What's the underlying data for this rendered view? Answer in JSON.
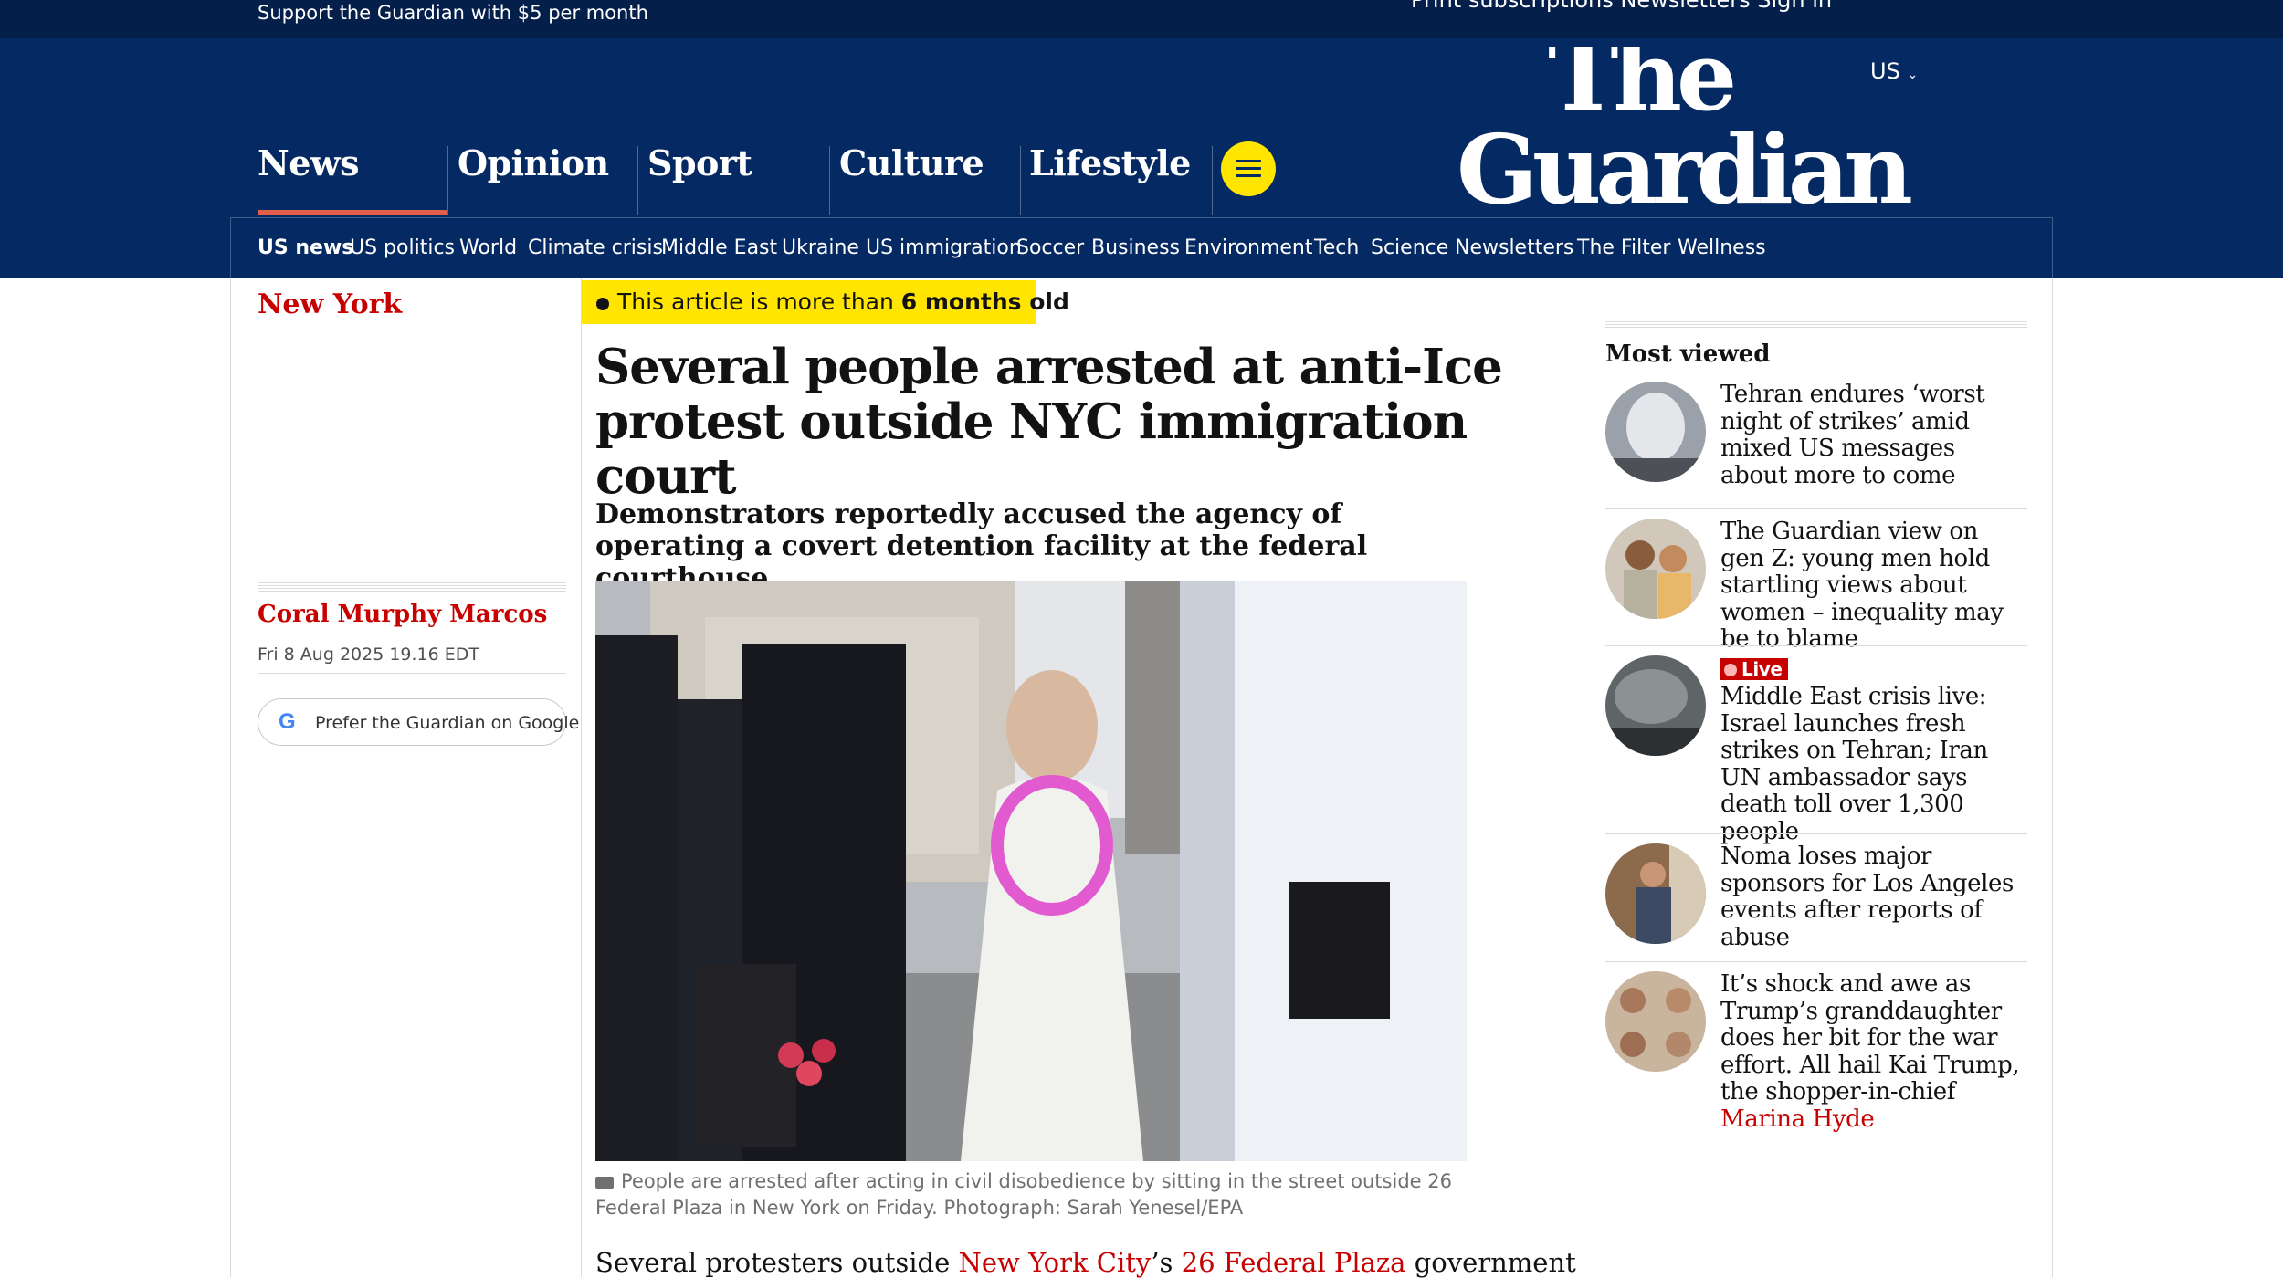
{
  "topbar": {
    "support_text": "Support the Guardian with $5 per month",
    "cut_links": "Print subscriptions     Newsletters     Sign in"
  },
  "header": {
    "edition": "US",
    "logo_line1": "The",
    "logo_line2": "Guardian",
    "pillars": [
      "News",
      "Opinion",
      "Sport",
      "Culture",
      "Lifestyle"
    ],
    "active_pillar": "News",
    "menu_icon": "hamburger-menu-icon",
    "subnav": [
      "US news",
      "US politics",
      "World",
      "Climate crisis",
      "Middle East",
      "Ukraine",
      "US immigration",
      "Soccer",
      "Business",
      "Environment",
      "Tech",
      "Science",
      "Newsletters",
      "The Filter",
      "Wellness"
    ]
  },
  "colors": {
    "brand_blue": "#052962",
    "accent_red": "#c70000",
    "highlight_yellow": "#ffe500",
    "pillar_underline": "#e05e4a"
  },
  "article": {
    "kicker": "New York",
    "age_notice_prefix": "This article is more than ",
    "age_notice_strong": "6 months old",
    "headline": "Several people arrested at anti-Ice protest outside NYC immigration court",
    "standfirst": "Demonstrators reportedly accused the agency of operating a covert detention facility at the federal courthouse",
    "byline": "Coral Murphy Marcos",
    "dateline": "Fri 8 Aug 2025 19.16 EDT",
    "google_button": "Prefer the Guardian on Google",
    "caption": "People are arrested after acting in civil disobedience by sitting in the street outside 26 Federal Plaza in New York on Friday. Photograph: Sarah Yenesel/EPA",
    "body_prefix": "Several protesters outside ",
    "body_link1": "New York City",
    "body_mid": "’s ",
    "body_link2": "26 Federal Plaza",
    "body_suffix": " government"
  },
  "most_viewed": {
    "title": "Most viewed",
    "items": [
      {
        "headline": "Tehran endures ‘worst night of strikes’ amid mixed US messages about more to come"
      },
      {
        "headline": "The Guardian view on gen Z: young men hold startling views about women – inequality may be to blame"
      },
      {
        "live_label": "Live",
        "headline": "Middle East crisis live: Israel launches fresh strikes on Tehran; Iran UN ambassador says death toll over 1,300 people"
      },
      {
        "headline": "Noma loses major sponsors for Los Angeles events after reports of abuse"
      },
      {
        "headline": "It’s shock and awe as Trump’s granddaughter does her bit for the war effort. All hail Kai Trump, the shopper-in-chief",
        "author": "Marina Hyde"
      }
    ]
  }
}
